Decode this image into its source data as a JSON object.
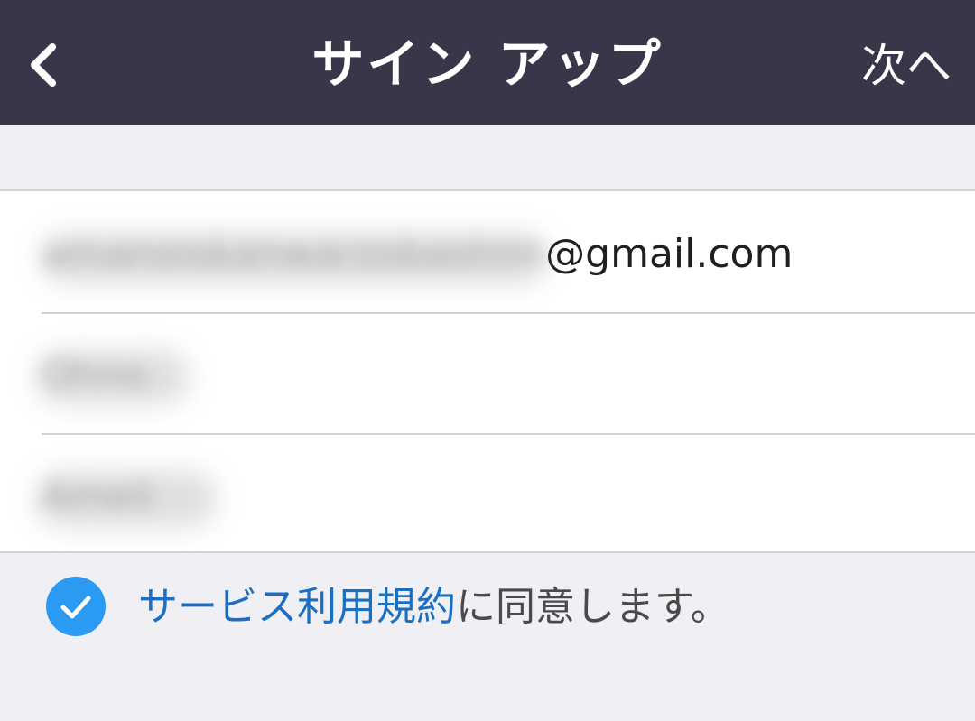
{
  "navbar": {
    "back_icon": "chevron-left-icon",
    "title": "サイン アップ",
    "next_label": "次へ",
    "background": "#393649"
  },
  "form": {
    "email": {
      "hidden_part": "amanoiskanwarzobashim",
      "visible_part": "@gmail.com"
    },
    "first_name": {
      "hidden_value": "Ohno"
    },
    "last_name": {
      "hidden_value": "Ameli"
    }
  },
  "consent": {
    "checked": true,
    "check_icon": "checkmark-icon",
    "check_color": "#2b9af3",
    "terms_link": "サービス利用規約",
    "suffix": "に同意します。",
    "link_color": "#1a6fc1"
  }
}
